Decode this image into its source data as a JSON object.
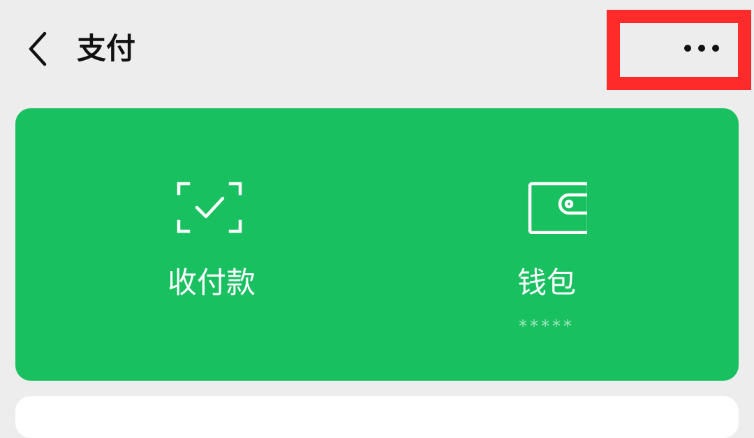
{
  "header": {
    "title": "支付",
    "back_icon": "chevron-left-icon",
    "more_icon": "more-horizontal-icon"
  },
  "card": {
    "items": [
      {
        "label": "收付款",
        "icon": "scan-check-icon"
      },
      {
        "label": "钱包",
        "sub": "*****",
        "icon": "wallet-icon"
      }
    ]
  },
  "colors": {
    "background": "#EDEDED",
    "card": "#19C060",
    "highlight": "#FF2A2A",
    "text": "#111111"
  }
}
